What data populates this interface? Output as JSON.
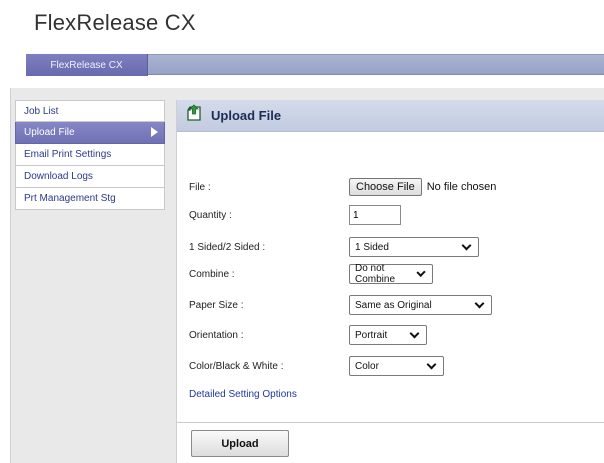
{
  "app": {
    "title": "FlexRelease CX"
  },
  "tabs": [
    {
      "label": "FlexRelease CX"
    }
  ],
  "sidebar": {
    "items": [
      {
        "label": "Job List",
        "active": false
      },
      {
        "label": "Upload File",
        "active": true
      },
      {
        "label": "Email Print Settings",
        "active": false
      },
      {
        "label": "Download Logs",
        "active": false
      },
      {
        "label": "Prt Management Stg",
        "active": false
      }
    ]
  },
  "panel": {
    "title": "Upload File",
    "icon": "upload-file-icon"
  },
  "form": {
    "file": {
      "label": "File :",
      "button": "Choose File",
      "status": "No file chosen"
    },
    "quantity": {
      "label": "Quantity :",
      "value": "1"
    },
    "sided": {
      "label": "1 Sided/2 Sided :",
      "value": "1 Sided"
    },
    "combine": {
      "label": "Combine :",
      "value": "Do not Combine"
    },
    "paper_size": {
      "label": "Paper Size :",
      "value": "Same as Original"
    },
    "orientation": {
      "label": "Orientation :",
      "value": "Portrait"
    },
    "color_mode": {
      "label": "Color/Black & White :",
      "value": "Color"
    },
    "detailed_link": "Detailed Setting Options"
  },
  "actions": {
    "upload_label": "Upload"
  },
  "colors": {
    "accent": "#7577ba",
    "header": "#c8d0e4",
    "link": "#2236a2"
  }
}
